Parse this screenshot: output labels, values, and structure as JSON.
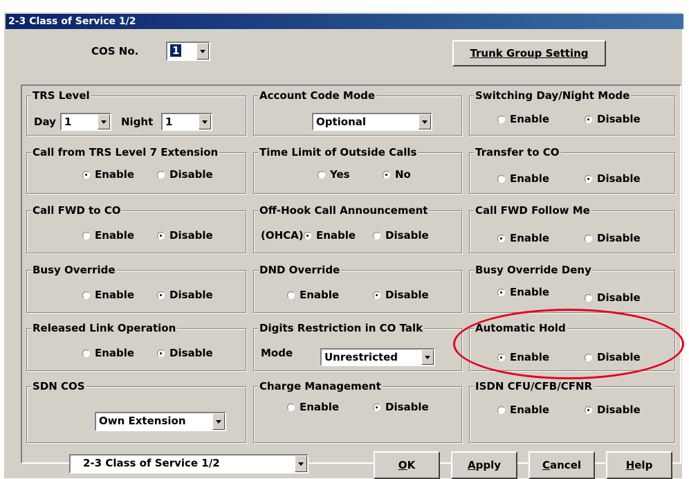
{
  "window": {
    "title": "2-3 Class of Service 1/2"
  },
  "header": {
    "cos_label": "COS No.",
    "cos_value": "1",
    "trunk_button": "Trunk Group Setting"
  },
  "groups": {
    "trs": {
      "title": "TRS Level",
      "day_label": "Day",
      "day_value": "1",
      "night_label": "Night",
      "night_value": "1"
    },
    "account": {
      "title": "Account Code Mode",
      "value": "Optional"
    },
    "switching": {
      "title": "Switching Day/Night Mode",
      "enable": "Enable",
      "disable": "Disable",
      "selected": "Disable"
    },
    "call_trs7": {
      "title": "Call from TRS Level 7 Extension",
      "enable": "Enable",
      "disable": "Disable",
      "selected": "Enable"
    },
    "time_limit": {
      "title": "Time Limit of Outside Calls",
      "yes": "Yes",
      "no": "No",
      "selected": "No"
    },
    "transfer_co": {
      "title": "Transfer to CO",
      "enable": "Enable",
      "disable": "Disable",
      "selected": "Disable"
    },
    "call_fwd_co": {
      "title": "Call FWD to CO",
      "enable": "Enable",
      "disable": "Disable",
      "selected": "Disable"
    },
    "ohca": {
      "title": "Off-Hook Call Announcement",
      "prefix": "(OHCA)",
      "enable": "Enable",
      "disable": "Disable",
      "selected": "Enable"
    },
    "fwd_follow": {
      "title": "Call FWD Follow Me",
      "enable": "Enable",
      "disable": "Disable",
      "selected": "Enable"
    },
    "busy_override": {
      "title": "Busy Override",
      "enable": "Enable",
      "disable": "Disable",
      "selected": "Disable"
    },
    "dnd_override": {
      "title": "DND Override",
      "enable": "Enable",
      "disable": "Disable",
      "selected": "Disable"
    },
    "busy_deny": {
      "title": "Busy Override Deny",
      "enable": "Enable",
      "disable": "Disable",
      "selected": "Enable"
    },
    "released_link": {
      "title": "Released Link Operation",
      "enable": "Enable",
      "disable": "Disable",
      "selected": "Disable"
    },
    "digits": {
      "title": "Digits Restriction in CO Talk",
      "mode_label": "Mode",
      "value": "Unrestricted"
    },
    "auto_hold": {
      "title": "Automatic Hold",
      "enable": "Enable",
      "disable": "Disable",
      "selected": "Enable"
    },
    "sdn_cos": {
      "title": "SDN COS",
      "value": "Own Extension"
    },
    "charge": {
      "title": "Charge Management",
      "enable": "Enable",
      "disable": "Disable",
      "selected": "Disable"
    },
    "isdn": {
      "title": "ISDN CFU/CFB/CFNR",
      "enable": "Enable",
      "disable": "Disable",
      "selected": "Disable"
    }
  },
  "footer": {
    "page_select": "2-3 Class of Service 1/2",
    "ok": {
      "u": "O",
      "rest": "K"
    },
    "apply": {
      "u": "A",
      "rest": "pply"
    },
    "cancel": {
      "u": "C",
      "rest": "ancel"
    },
    "help": {
      "u": "H",
      "rest": "elp"
    }
  },
  "annotation": {
    "color": "#e5001a"
  }
}
